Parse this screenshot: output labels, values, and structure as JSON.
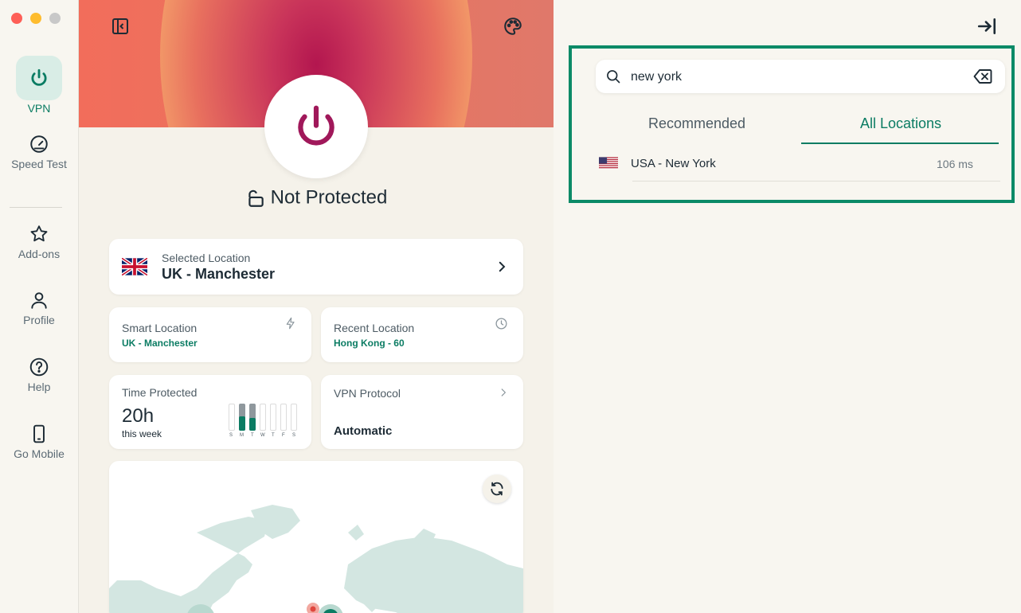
{
  "nav": {
    "items": [
      {
        "label": "VPN"
      },
      {
        "label": "Speed Test"
      },
      {
        "label": "Add-ons"
      },
      {
        "label": "Profile"
      },
      {
        "label": "Help"
      },
      {
        "label": "Go Mobile"
      }
    ]
  },
  "main": {
    "status": "Not Protected",
    "selected": {
      "label": "Selected Location",
      "value": "UK - Manchester"
    },
    "smart": {
      "label": "Smart Location",
      "value": "UK - Manchester"
    },
    "recent": {
      "label": "Recent Location",
      "value": "Hong Kong - 60"
    },
    "time": {
      "label": "Time Protected",
      "value": "20h",
      "sub": "this week",
      "days": [
        "S",
        "M",
        "T",
        "W",
        "T",
        "F",
        "S"
      ]
    },
    "protocol": {
      "label": "VPN Protocol",
      "value": "Automatic"
    }
  },
  "search": {
    "value": "new york"
  },
  "tabs": [
    {
      "label": "Recommended",
      "active": false
    },
    {
      "label": "All Locations",
      "active": true
    }
  ],
  "results": [
    {
      "name": "USA - New York",
      "latency": "106 ms"
    }
  ],
  "colors": {
    "accent": "#0b7c63",
    "highlight_border": "#0b8a67",
    "power": "#a0185a"
  }
}
